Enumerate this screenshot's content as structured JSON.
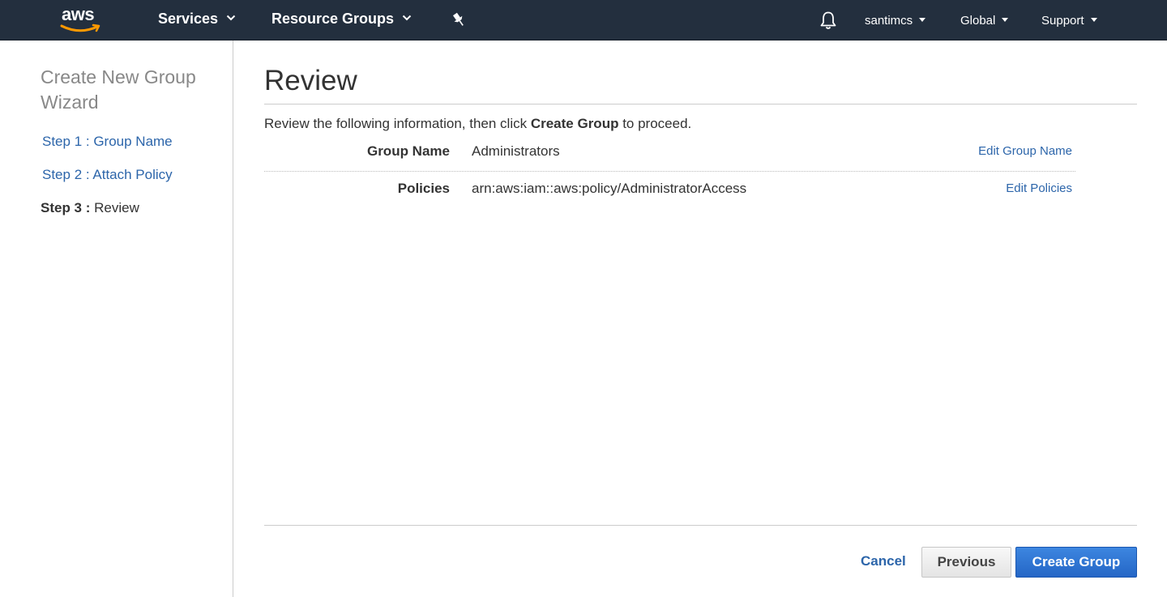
{
  "nav": {
    "logo_text": "aws",
    "services": "Services",
    "resource_groups": "Resource Groups",
    "user": "santimcs",
    "region": "Global",
    "support": "Support",
    "icons": [
      "aws-logo",
      "chevron-down-icon",
      "pin-icon",
      "bell-icon",
      "caret-down-icon"
    ]
  },
  "sidebar": {
    "title": "Create New Group Wizard",
    "steps": [
      {
        "label": "Step 1 : Group Name"
      },
      {
        "label": "Step 2 : Attach Policy"
      },
      {
        "prefix": "Step 3 :",
        "label": "Review"
      }
    ]
  },
  "main": {
    "heading": "Review",
    "intro_before": "Review the following information, then click ",
    "intro_bold": "Create Group",
    "intro_after": " to proceed.",
    "rows": [
      {
        "label": "Group Name",
        "value": "Administrators",
        "edit": "Edit Group Name"
      },
      {
        "label": "Policies",
        "value": "arn:aws:iam::aws:policy/AdministratorAccess",
        "edit": "Edit Policies"
      }
    ]
  },
  "footer": {
    "cancel": "Cancel",
    "previous": "Previous",
    "create": "Create Group"
  },
  "colors": {
    "nav_bg": "#232f3e",
    "link": "#2c65aa",
    "primary_button": "#2a6fd6",
    "logo_smile": "#ff9900"
  }
}
